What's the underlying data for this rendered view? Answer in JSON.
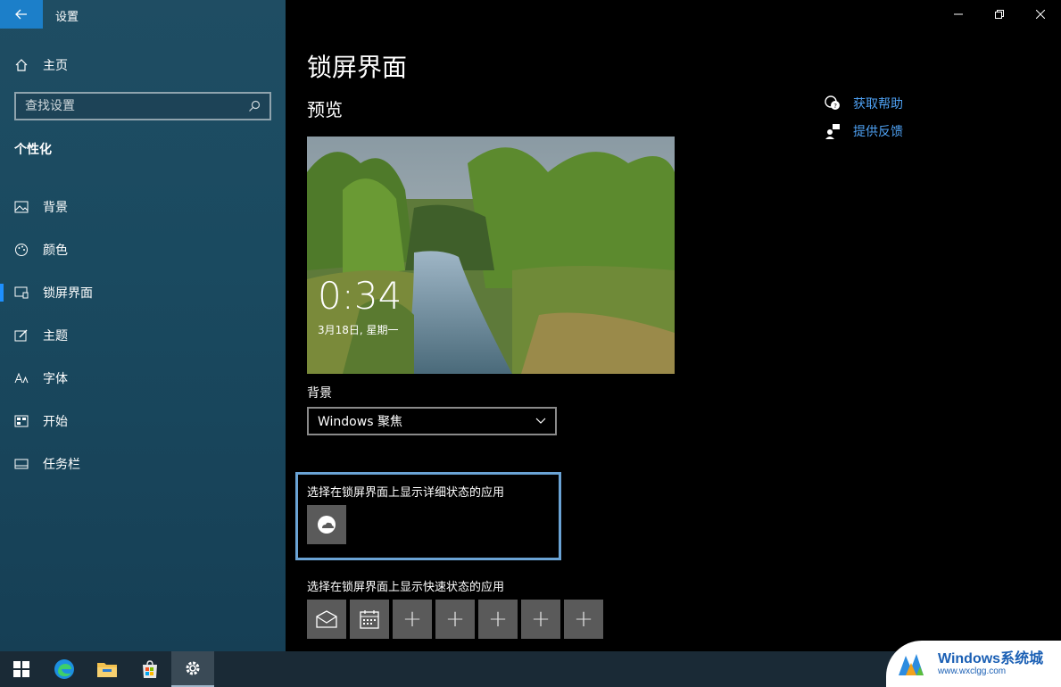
{
  "window": {
    "title": "设置"
  },
  "sidebar": {
    "home_label": "主页",
    "search_placeholder": "查找设置",
    "section": "个性化",
    "items": [
      {
        "label": "背景",
        "icon": "image-icon"
      },
      {
        "label": "颜色",
        "icon": "palette-icon"
      },
      {
        "label": "锁屏界面",
        "icon": "lockscreen-icon",
        "active": true
      },
      {
        "label": "主题",
        "icon": "theme-icon"
      },
      {
        "label": "字体",
        "icon": "font-icon"
      },
      {
        "label": "开始",
        "icon": "start-icon"
      },
      {
        "label": "任务栏",
        "icon": "taskbar-icon"
      }
    ]
  },
  "main": {
    "title": "锁屏界面",
    "preview_title": "预览",
    "preview_time": "0:34",
    "preview_date": "3月18日, 星期一",
    "background_label": "背景",
    "background_value": "Windows 聚焦",
    "detail_label": "选择在锁屏界面上显示详细状态的应用",
    "quick_label": "选择在锁屏界面上显示快速状态的应用"
  },
  "help": {
    "get_help": "获取帮助",
    "feedback": "提供反馈"
  },
  "watermark": {
    "title": "Windows系统城",
    "url": "www.wxclgg.com"
  },
  "colors": {
    "accent": "#1e90ff",
    "link": "#4ea1f3",
    "highlight_border": "#6aa3d5"
  }
}
